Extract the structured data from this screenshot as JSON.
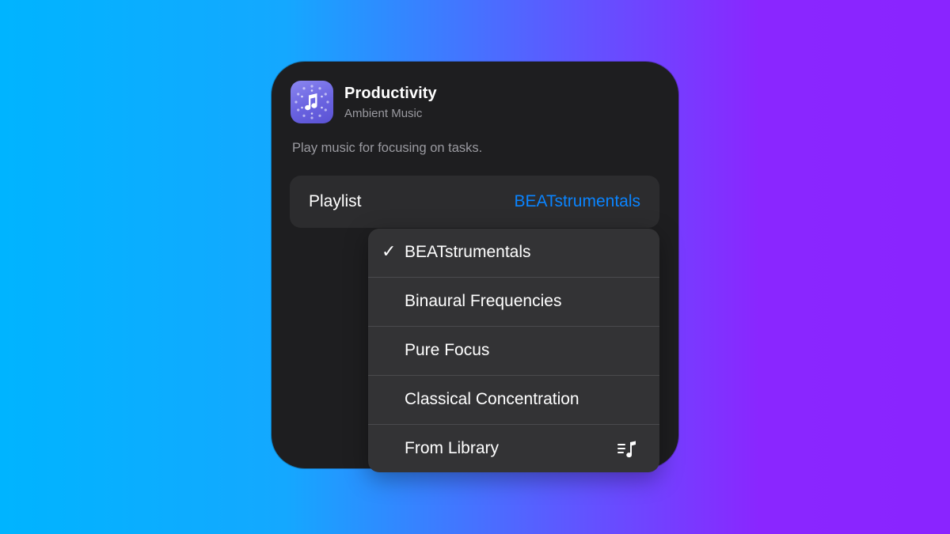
{
  "card": {
    "app_name": "Productivity",
    "app_subtitle": "Ambient Music",
    "app_icon": "music-note-sparkle-icon",
    "description": "Play music for focusing on tasks."
  },
  "parameter": {
    "label": "Playlist",
    "value": "BEATstrumentals"
  },
  "menu": {
    "selected": "BEATstrumentals",
    "items": [
      {
        "label": "BEATstrumentals",
        "checked": "✓"
      },
      {
        "label": "Binaural Frequencies"
      },
      {
        "label": "Pure Focus"
      },
      {
        "label": "Classical Concentration"
      },
      {
        "label": "From Library",
        "icon": "music-library-icon"
      }
    ]
  },
  "colors": {
    "accent": "#0a84ff",
    "card_bg": "#1e1e20",
    "row_bg": "#2c2c2e",
    "menu_bg": "#333335",
    "icon_bg": "#6a63e0"
  }
}
